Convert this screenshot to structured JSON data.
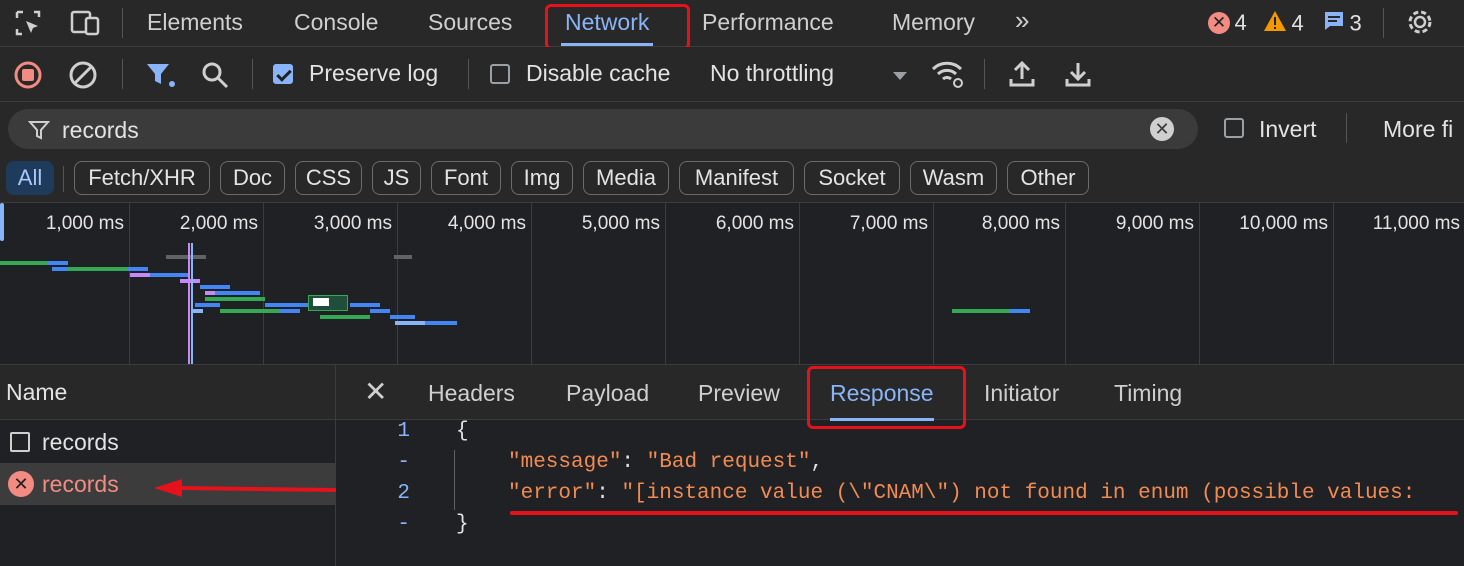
{
  "tabs": {
    "elements": "Elements",
    "console": "Console",
    "sources": "Sources",
    "network": "Network",
    "performance": "Performance",
    "memory": "Memory",
    "more": "»"
  },
  "badges": {
    "errors": "4",
    "warnings": "4",
    "messages": "3"
  },
  "toolbar": {
    "preserve_log": "Preserve log",
    "disable_cache": "Disable cache",
    "throttling": "No throttling"
  },
  "filter": {
    "value": "records",
    "invert": "Invert",
    "more_filters": "More fi"
  },
  "type_filters": [
    "All",
    "Fetch/XHR",
    "Doc",
    "CSS",
    "JS",
    "Font",
    "Img",
    "Media",
    "Manifest",
    "Socket",
    "Wasm",
    "Other"
  ],
  "timeline_ticks": [
    "1,000 ms",
    "2,000 ms",
    "3,000 ms",
    "4,000 ms",
    "5,000 ms",
    "6,000 ms",
    "7,000 ms",
    "8,000 ms",
    "9,000 ms",
    "10,000 ms",
    "11,000 ms"
  ],
  "requests": {
    "header": "Name",
    "rows": [
      {
        "name": "records",
        "status": "ok"
      },
      {
        "name": "records",
        "status": "error"
      }
    ]
  },
  "detail_tabs": {
    "headers": "Headers",
    "payload": "Payload",
    "preview": "Preview",
    "response": "Response",
    "initiator": "Initiator",
    "timing": "Timing"
  },
  "response": {
    "lines": [
      {
        "num": "1",
        "text": "{"
      },
      {
        "num": "-",
        "key": "\"message\"",
        "value": "\"Bad request\"",
        "trail": ","
      },
      {
        "num": "2",
        "key": "\"error\"",
        "value": "\"[instance value (\\\"CNAM\\\") not found in enum (possible values:",
        "trail": ""
      },
      {
        "num": "-",
        "text": "}"
      }
    ]
  },
  "colors": {
    "accent": "#8ab4f8",
    "error": "#f28b82",
    "warning": "#f29900",
    "annotation": "#e5121b",
    "json_string": "#f28b52"
  }
}
